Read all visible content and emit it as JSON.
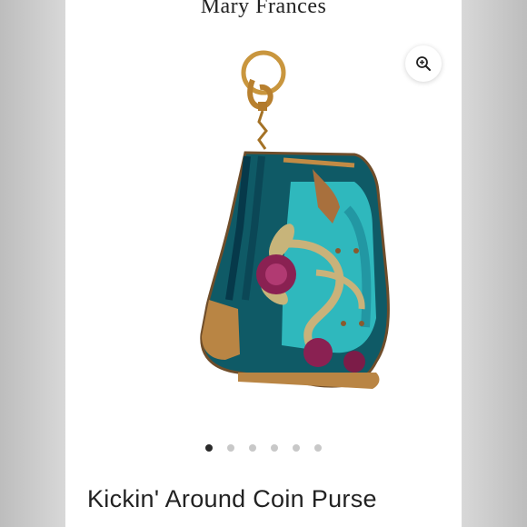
{
  "brand": {
    "name": "Mary Frances"
  },
  "toolbar": {
    "zoom_icon": "zoom-in-icon"
  },
  "gallery": {
    "image_count": 6,
    "active_index": 0
  },
  "product": {
    "title": "Kickin' Around Coin Purse"
  },
  "colors": {
    "turquoise": "#2fb8bd",
    "teal_dark": "#0e4f5a",
    "gold": "#c48a3c",
    "rose": "#8a2152",
    "active_dot": "#2a2a2a",
    "inactive_dot": "#c8c8c8"
  }
}
